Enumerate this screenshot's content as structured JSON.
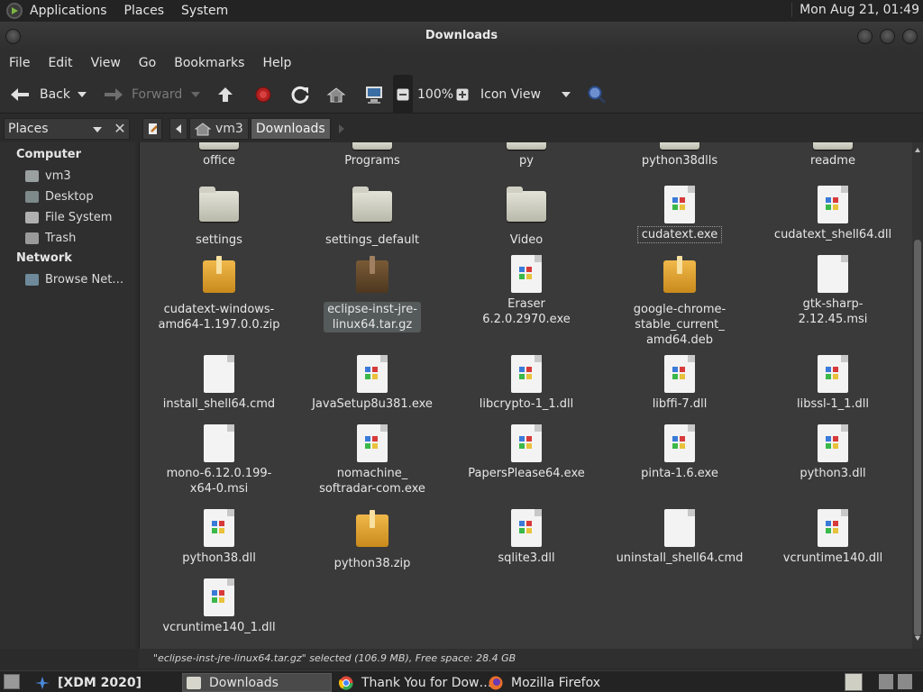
{
  "top_panel": {
    "menus": [
      "Applications",
      "Places",
      "System"
    ],
    "clock": "Mon Aug 21, 01:49"
  },
  "window": {
    "title": "Downloads"
  },
  "menubar": [
    "File",
    "Edit",
    "View",
    "Go",
    "Bookmarks",
    "Help"
  ],
  "toolbar": {
    "back": "Back",
    "forward": "Forward",
    "zoom": "100%",
    "view_mode": "Icon View"
  },
  "location": {
    "sidebar_mode": "Places",
    "crumbs": [
      "vm3",
      "Downloads"
    ]
  },
  "sidebar": {
    "computer_header": "Computer",
    "computer_items": [
      "vm3",
      "Desktop",
      "File System",
      "Trash"
    ],
    "network_header": "Network",
    "network_items": [
      "Browse Net…"
    ]
  },
  "files": [
    {
      "name": "office",
      "type": "folder-cut"
    },
    {
      "name": "Programs",
      "type": "folder-cut"
    },
    {
      "name": "py",
      "type": "folder-cut"
    },
    {
      "name": "python38dlls",
      "type": "folder-cut"
    },
    {
      "name": "readme",
      "type": "folder-cut"
    },
    {
      "name": "settings",
      "type": "folder"
    },
    {
      "name": "settings_default",
      "type": "folder"
    },
    {
      "name": "Video",
      "type": "folder"
    },
    {
      "name": "cudatext.exe",
      "type": "exe",
      "focused": true
    },
    {
      "name": "cudatext_shell64.dll",
      "type": "exe"
    },
    {
      "name": "cudatext-windows-amd64-1.197.0.0.zip",
      "display": [
        "cudatext-windows-",
        "amd64-1.197.0.0.zip"
      ],
      "type": "archive"
    },
    {
      "name": "eclipse-inst-jre-linux64.tar.gz",
      "display": [
        "eclipse-inst-jre-",
        "linux64.tar.gz"
      ],
      "type": "archive-dark",
      "selected": true
    },
    {
      "name": "Eraser 6.2.0.2970.exe",
      "type": "exe"
    },
    {
      "name": "google-chrome-stable_current_amd64.deb",
      "display": [
        "google-chrome-",
        "stable_current_",
        "amd64.deb"
      ],
      "type": "archive"
    },
    {
      "name": "gtk-sharp-2.12.45.msi",
      "type": "doc"
    },
    {
      "name": "install_shell64.cmd",
      "type": "doc"
    },
    {
      "name": "JavaSetup8u381.exe",
      "type": "exe"
    },
    {
      "name": "libcrypto-1_1.dll",
      "type": "exe"
    },
    {
      "name": "libffi-7.dll",
      "type": "exe"
    },
    {
      "name": "libssl-1_1.dll",
      "type": "exe"
    },
    {
      "name": "mono-6.12.0.199-x64-0.msi",
      "display": [
        "mono-6.12.0.199-",
        "x64-0.msi"
      ],
      "type": "doc"
    },
    {
      "name": "nomachine_softradar-com.exe",
      "display": [
        "nomachine_",
        "softradar-com.exe"
      ],
      "type": "exe"
    },
    {
      "name": "PapersPlease64.exe",
      "type": "exe"
    },
    {
      "name": "pinta-1.6.exe",
      "type": "exe"
    },
    {
      "name": "python3.dll",
      "type": "exe"
    },
    {
      "name": "python38.dll",
      "type": "exe"
    },
    {
      "name": "python38.zip",
      "type": "archive"
    },
    {
      "name": "sqlite3.dll",
      "type": "exe"
    },
    {
      "name": "uninstall_shell64.cmd",
      "type": "doc"
    },
    {
      "name": "vcruntime140.dll",
      "type": "exe"
    },
    {
      "name": "vcruntime140_1.dll",
      "type": "exe"
    }
  ],
  "status": "\"eclipse-inst-jre-linux64.tar.gz\" selected (106.9 MB), Free space: 28.4 GB",
  "taskbar": {
    "tasks": [
      "[XDM 2020]",
      "Downloads",
      "Thank You for Dow…",
      "Mozilla Firefox"
    ]
  },
  "colors": {
    "panel_bg": "#232323",
    "content_bg": "#3a3a3a",
    "selection_bg": "#555a5a"
  }
}
